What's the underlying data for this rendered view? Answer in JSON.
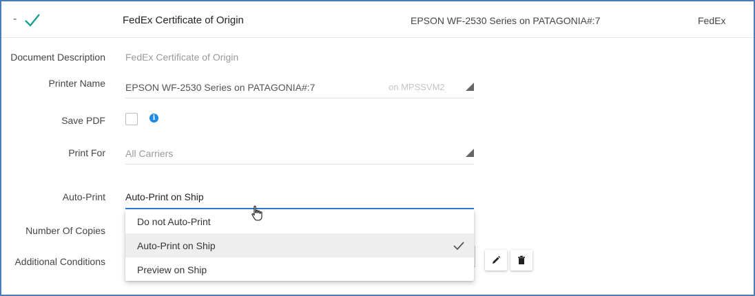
{
  "header": {
    "collapse_symbol": "-",
    "document_name": "FedEx Certificate of Origin",
    "printer": "EPSON WF-2530 Series on PATAGONIA#:7",
    "carrier": "FedEx"
  },
  "form": {
    "document_description": {
      "label": "Document Description",
      "value": "FedEx Certificate of Origin"
    },
    "printer_name": {
      "label": "Printer Name",
      "value": "EPSON WF-2530 Series on PATAGONIA#:7",
      "host": "on MPSSVM2"
    },
    "save_pdf": {
      "label": "Save PDF",
      "checked": false,
      "info_symbol": "i"
    },
    "print_for": {
      "label": "Print For",
      "value": "All Carriers"
    },
    "auto_print": {
      "label": "Auto-Print",
      "value": "Auto-Print on Ship",
      "options": [
        "Do not Auto-Print",
        "Auto-Print on Ship",
        "Preview on Ship"
      ],
      "selected_index": 1
    },
    "number_of_copies": {
      "label": "Number Of Copies"
    },
    "additional_conditions": {
      "label": "Additional Conditions"
    }
  },
  "colors": {
    "accent": "#2a7ed8",
    "check_green": "#1a9e8c",
    "frame": "#4a7ab8"
  }
}
